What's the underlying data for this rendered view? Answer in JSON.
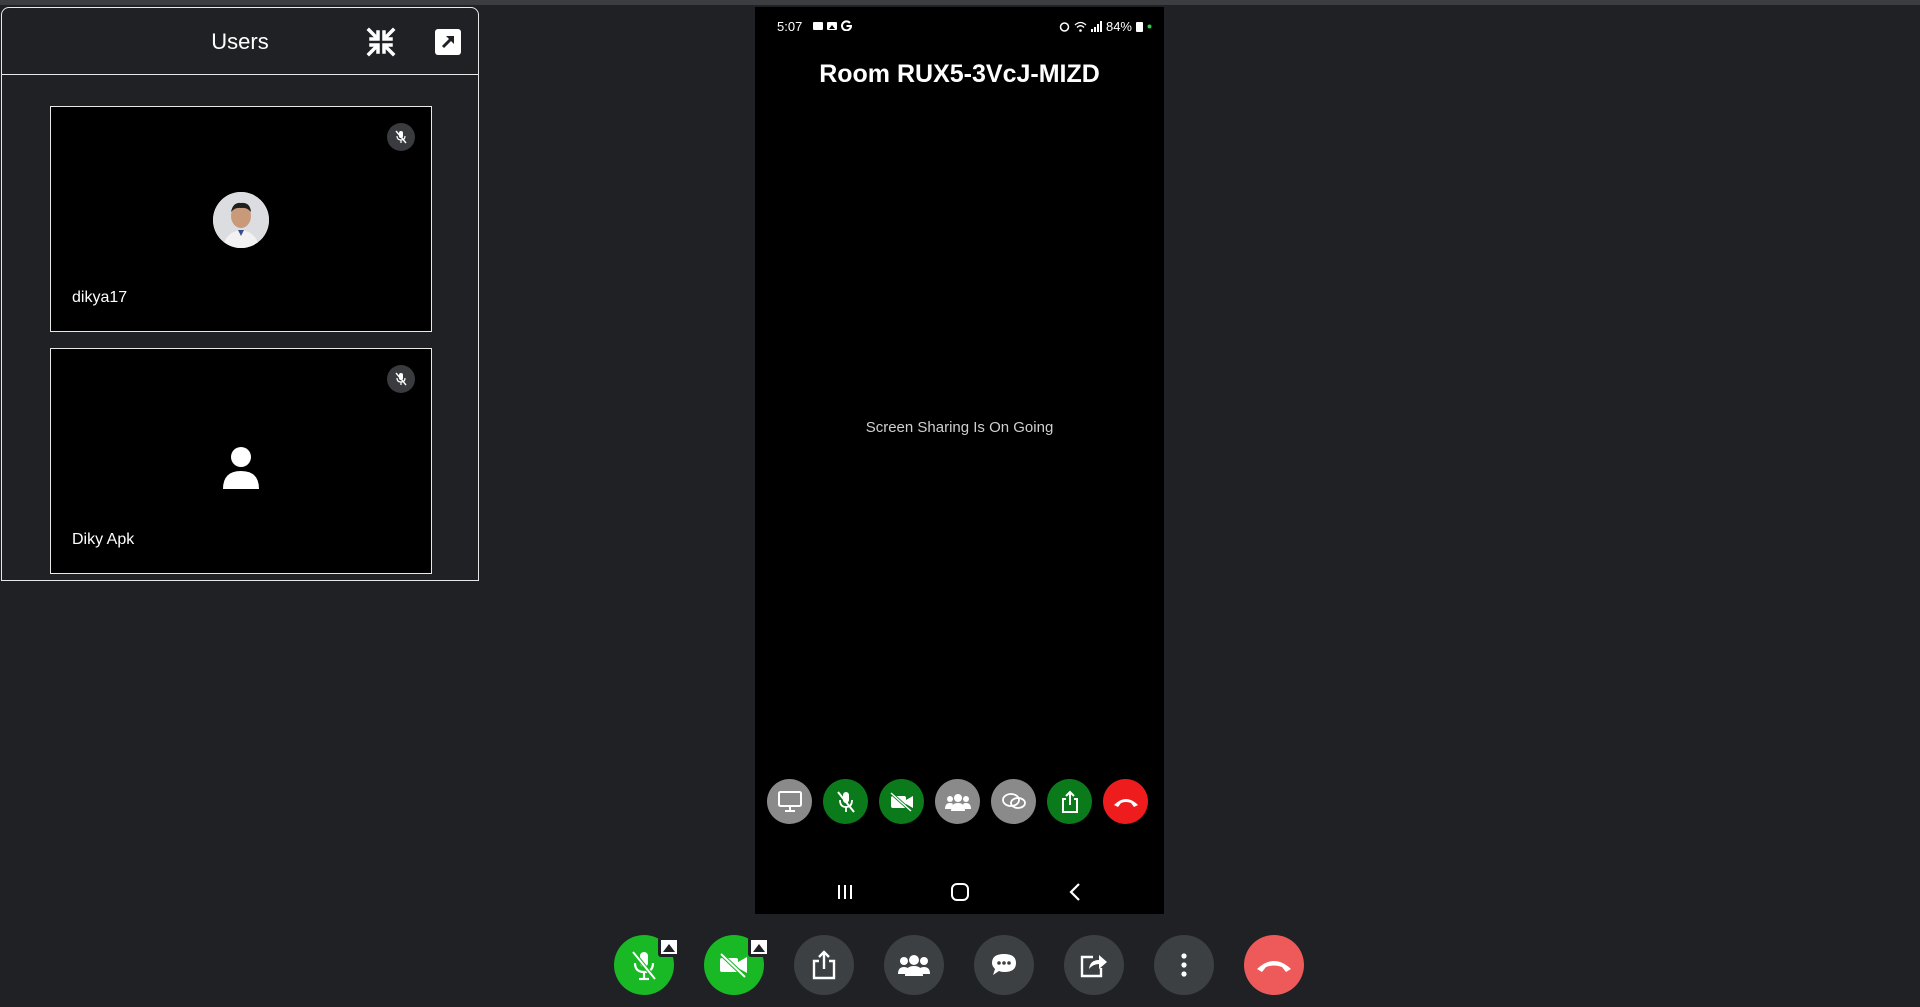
{
  "users_panel": {
    "title": "Users",
    "participants": [
      {
        "name": "dikya17",
        "muted": true,
        "avatar": "photo"
      },
      {
        "name": "Diky Apk",
        "muted": true,
        "avatar": "generic-person-icon"
      }
    ]
  },
  "shared_screen": {
    "status_time": "5:07",
    "status_battery": "84%",
    "room_title": "Room RUX5-3VcJ-MIZD",
    "sharing_message": "Screen Sharing Is On Going"
  },
  "colors": {
    "background": "#202124",
    "active_green": "#18b924",
    "end_call_red": "#ee5a5a",
    "control_dark": "#3c4043"
  }
}
